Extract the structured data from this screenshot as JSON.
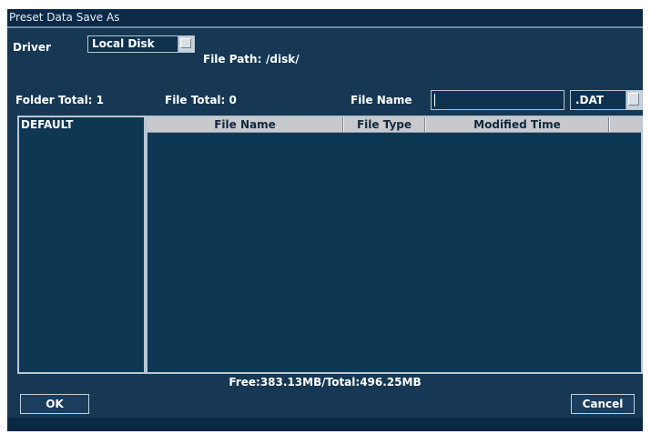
{
  "window": {
    "title": "Preset Data Save As"
  },
  "driver": {
    "label": "Driver",
    "selected": "Local Disk"
  },
  "file_path": {
    "label": "File Path:",
    "value": "/disk/"
  },
  "counts": {
    "folder_total": "Folder Total: 1",
    "file_total": "File Total: 0"
  },
  "file_name": {
    "label": "File Name",
    "value": "",
    "extension": ".DAT"
  },
  "folders": [
    "DEFAULT"
  ],
  "file_table": {
    "columns": [
      "File Name",
      "File Type",
      "Modified Time"
    ],
    "rows": []
  },
  "disk_info": "Free:383.13MB/Total:496.25MB",
  "buttons": {
    "ok": "OK",
    "cancel": "Cancel"
  },
  "colors": {
    "dialog_bg": "#163854",
    "titlebar_bg": "#0c2a48",
    "panel_bg": "#0e3753",
    "header_bg": "#c8c9cc"
  }
}
